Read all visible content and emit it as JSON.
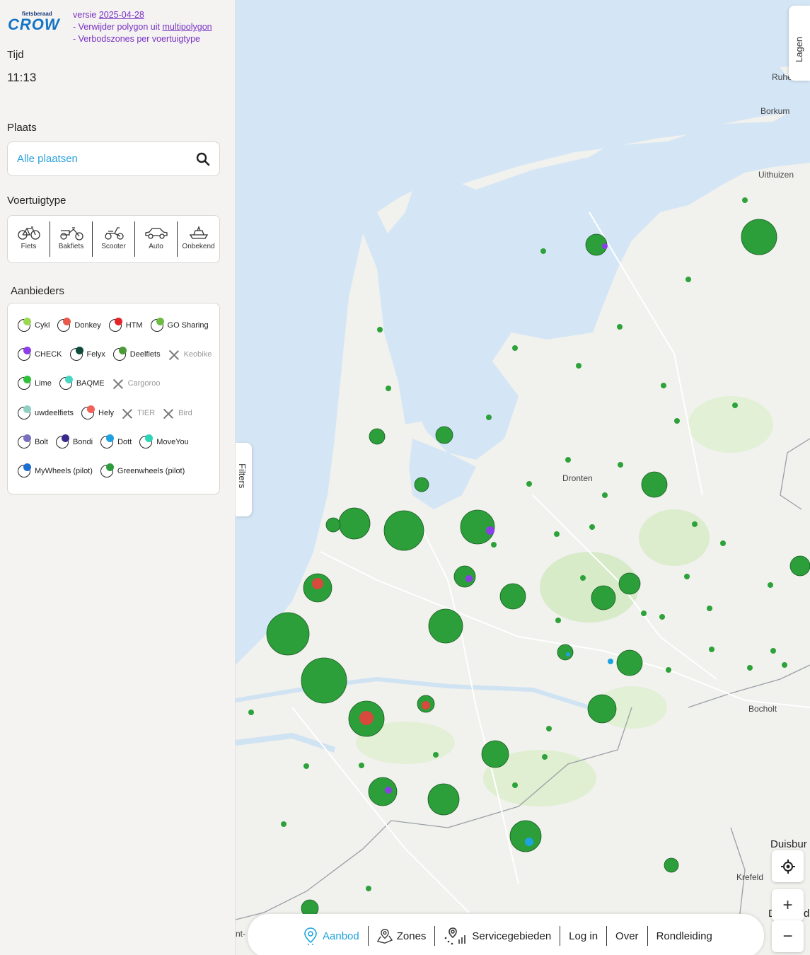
{
  "header": {
    "logo_small": "fietsberaad",
    "logo_big": "CROW",
    "version_prefix": "versie ",
    "version_link": "2025-04-28",
    "change1_prefix": "- Verwijder polygon uit ",
    "change1_link": "multipolygon",
    "change2": "- Verbodszones per voertuigtype"
  },
  "time": {
    "label": "Tijd",
    "value": "11:13"
  },
  "place": {
    "label": "Plaats",
    "placeholder": "Alle plaatsen"
  },
  "vehicle": {
    "label": "Voertuigtype",
    "types": [
      {
        "label": "Fiets",
        "icon": "bicycle-icon"
      },
      {
        "label": "Bakfiets",
        "icon": "cargo-bike-icon"
      },
      {
        "label": "Scooter",
        "icon": "scooter-icon"
      },
      {
        "label": "Auto",
        "icon": "car-icon"
      },
      {
        "label": "Onbekend",
        "icon": "unknown-vehicle-icon"
      }
    ]
  },
  "providers": {
    "label": "Aanbieders",
    "rows": [
      [
        {
          "name": "Cykl",
          "color": "#9ad94f",
          "on": true
        },
        {
          "name": "Donkey",
          "color": "#ea5a4b",
          "on": true
        },
        {
          "name": "HTM",
          "color": "#e3242b",
          "on": true
        },
        {
          "name": "GO Sharing",
          "color": "#6dbb44",
          "on": true
        }
      ],
      [
        {
          "name": "CHECK",
          "color": "#8c3ee8",
          "on": true
        },
        {
          "name": "Felyx",
          "color": "#0d4a3b",
          "on": true
        },
        {
          "name": "Deelfiets",
          "color": "#4a9b38",
          "on": true
        },
        {
          "name": "Keobike",
          "color": "",
          "on": false
        }
      ],
      [
        {
          "name": "Lime",
          "color": "#2ec23a",
          "on": true
        },
        {
          "name": "BAQME",
          "color": "#48d6c3",
          "on": true
        },
        {
          "name": "Cargoroo",
          "color": "",
          "on": false
        }
      ],
      [
        {
          "name": "uwdeelfiets",
          "color": "#8fcfc4",
          "on": true
        },
        {
          "name": "Hely",
          "color": "#f2625a",
          "on": true
        },
        {
          "name": "TIER",
          "color": "",
          "on": false
        },
        {
          "name": "Bird",
          "color": "",
          "on": false
        }
      ],
      [
        {
          "name": "Bolt",
          "color": "#7a70c2",
          "on": true
        },
        {
          "name": "Bondi",
          "color": "#3b2a8c",
          "on": true
        },
        {
          "name": "Dott",
          "color": "#1ea3e0",
          "on": true
        },
        {
          "name": "MoveYou",
          "color": "#2cd4b8",
          "on": true
        }
      ],
      [
        {
          "name": "MyWheels (pilot)",
          "color": "#1b6fd0",
          "on": true
        },
        {
          "name": "Greenwheels (pilot)",
          "color": "#2e9c3a",
          "on": true
        }
      ]
    ]
  },
  "map": {
    "places": [
      "Ruhezone",
      "Borkum",
      "Uithuizen",
      "Dronten",
      "Bocholt",
      "Duisbur",
      "Krefeld",
      "nt-",
      "D",
      "d"
    ],
    "lagen_tab": "Lagen",
    "filters_tab": "Filters",
    "zoom_in": "+",
    "zoom_out": "−"
  },
  "nav": {
    "aanbod": "Aanbod",
    "zones": "Zones",
    "servicegebieden": "Servicegebieden",
    "login": "Log in",
    "over": "Over",
    "rondleiding": "Rondleiding"
  }
}
